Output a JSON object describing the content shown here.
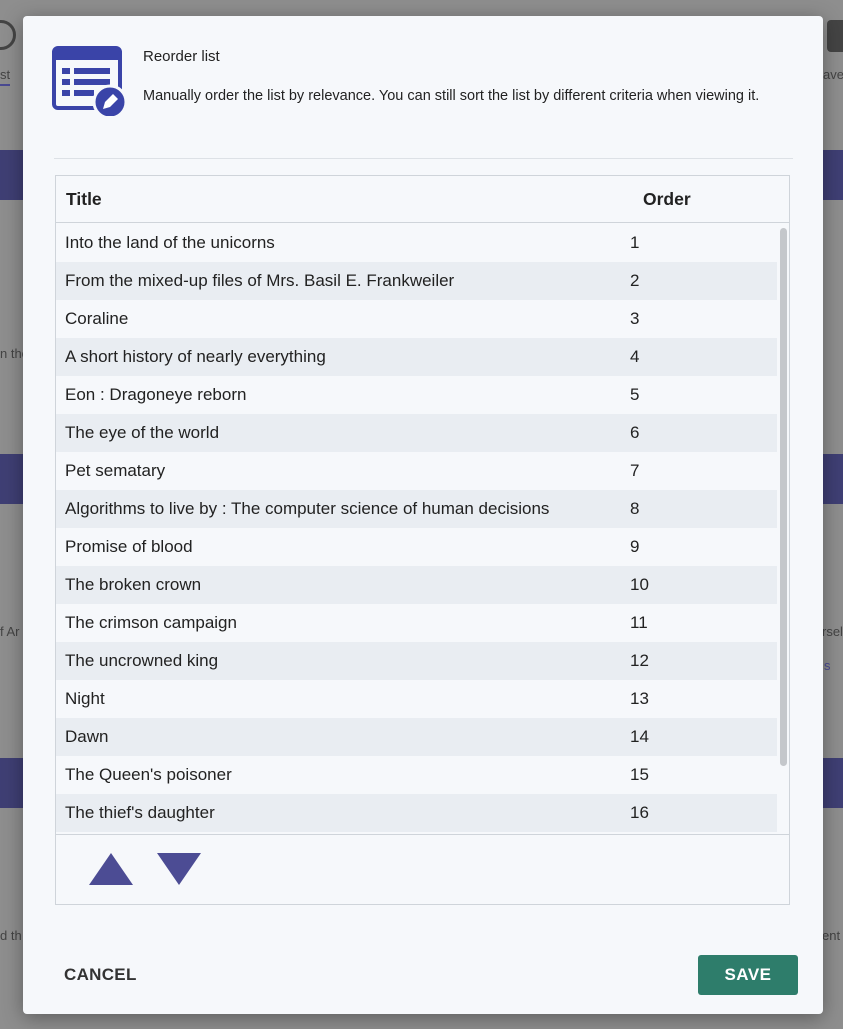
{
  "background": {
    "tab_partial": "st",
    "right_partial": "ave",
    "snippets": [
      "n the",
      "f Ar",
      "rsel",
      "s",
      "d th",
      "ent"
    ]
  },
  "dialog": {
    "icon": "list-edit-icon",
    "title": "Reorder list",
    "description": "Manually order the list by relevance. You can still sort the list by different criteria when viewing it.",
    "columns": {
      "title": "Title",
      "order": "Order"
    },
    "rows": [
      {
        "title": "Into the land of the unicorns",
        "order": "1"
      },
      {
        "title": "From the mixed-up files of Mrs. Basil E. Frankweiler",
        "order": "2"
      },
      {
        "title": "Coraline",
        "order": "3"
      },
      {
        "title": "A short history of nearly everything",
        "order": "4"
      },
      {
        "title": "Eon : Dragoneye reborn",
        "order": "5"
      },
      {
        "title": "The eye of the world",
        "order": "6"
      },
      {
        "title": "Pet sematary",
        "order": "7"
      },
      {
        "title": "Algorithms to live by : The computer science of human decisions",
        "order": "8"
      },
      {
        "title": "Promise of blood",
        "order": "9"
      },
      {
        "title": "The broken crown",
        "order": "10"
      },
      {
        "title": "The crimson campaign",
        "order": "11"
      },
      {
        "title": "The uncrowned king",
        "order": "12"
      },
      {
        "title": "Night",
        "order": "13"
      },
      {
        "title": "Dawn",
        "order": "14"
      },
      {
        "title": "The Queen's poisoner",
        "order": "15"
      },
      {
        "title": "The thief's daughter",
        "order": "16"
      }
    ],
    "buttons": {
      "cancel": "CANCEL",
      "save": "SAVE"
    }
  },
  "colors": {
    "accent": "#4c4c94",
    "save": "#2e7d6b",
    "band": "#3f3f74"
  }
}
